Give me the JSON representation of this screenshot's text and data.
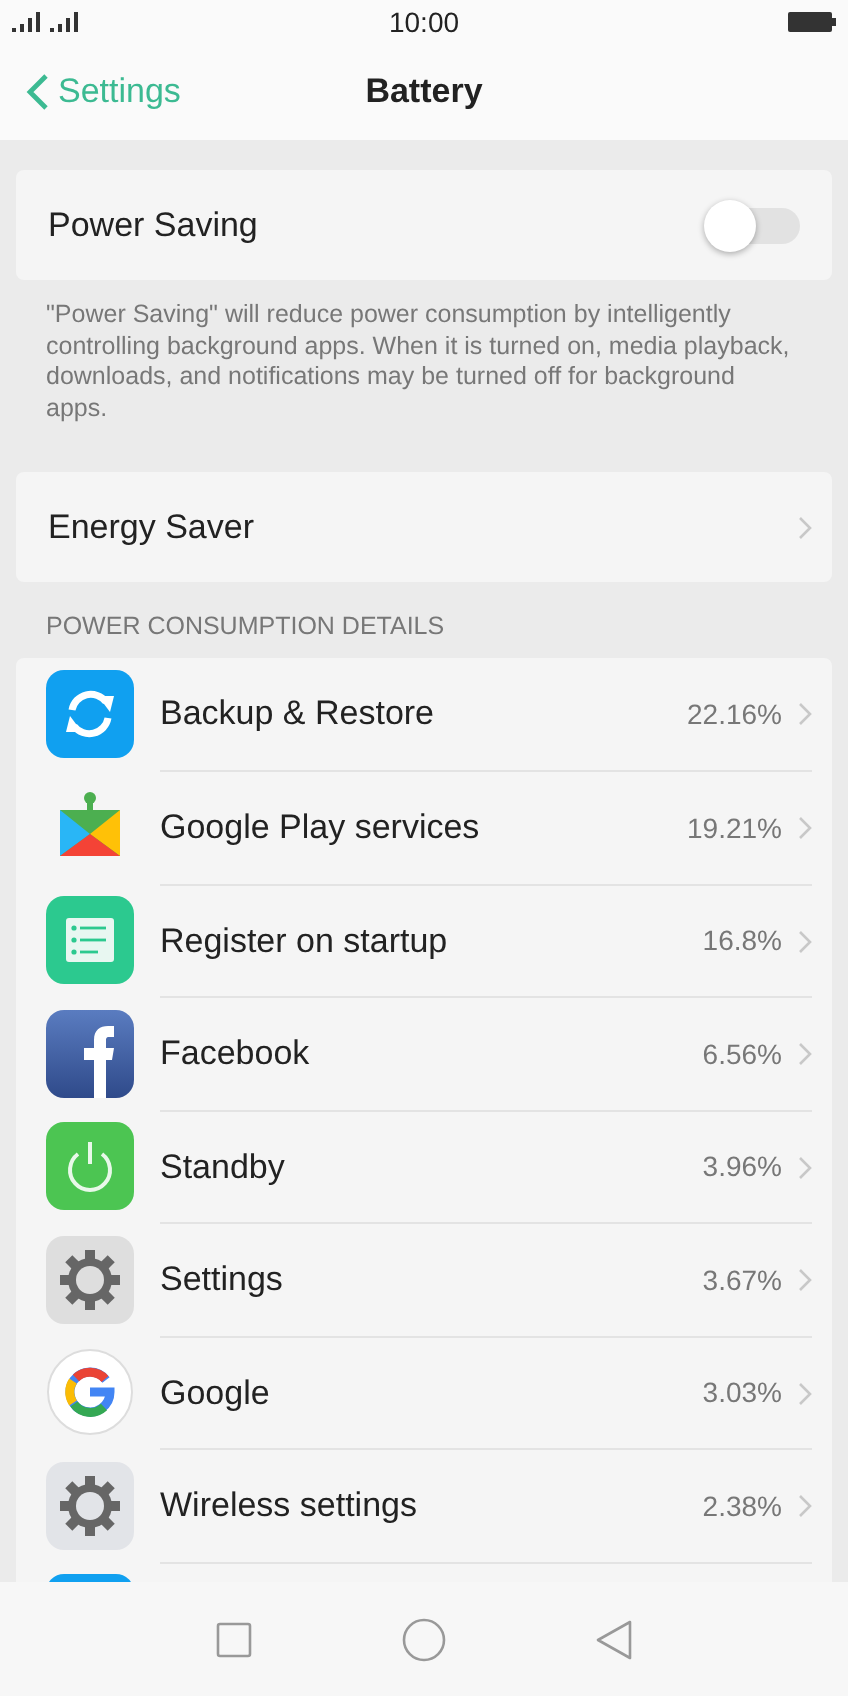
{
  "status_bar": {
    "time": "10:00"
  },
  "nav": {
    "back_label": "Settings",
    "title": "Battery"
  },
  "power_saving": {
    "label": "Power Saving",
    "on": false,
    "description": "\"Power Saving\" will reduce power consumption by intelligently controlling background apps. When it is turned on, media playback, downloads, and notifications may be turned off for background apps."
  },
  "energy_saver": {
    "label": "Energy Saver"
  },
  "details": {
    "header": "POWER CONSUMPTION DETAILS",
    "apps": [
      {
        "kind": "sync",
        "name": "Backup & Restore",
        "usage": "22.16%"
      },
      {
        "kind": "puzzle",
        "name": "Google Play services",
        "usage": "19.21%"
      },
      {
        "kind": "list",
        "name": "Register on startup",
        "usage": "16.8%"
      },
      {
        "kind": "facebook",
        "name": "Facebook",
        "usage": "6.56%"
      },
      {
        "kind": "power",
        "name": "Standby",
        "usage": "3.96%"
      },
      {
        "kind": "gear",
        "name": "Settings",
        "usage": "3.67%"
      },
      {
        "kind": "google",
        "name": "Google",
        "usage": "3.03%"
      },
      {
        "kind": "gear-flat",
        "name": "Wireless settings",
        "usage": "2.38%"
      },
      {
        "kind": "cut-off"
      }
    ]
  }
}
